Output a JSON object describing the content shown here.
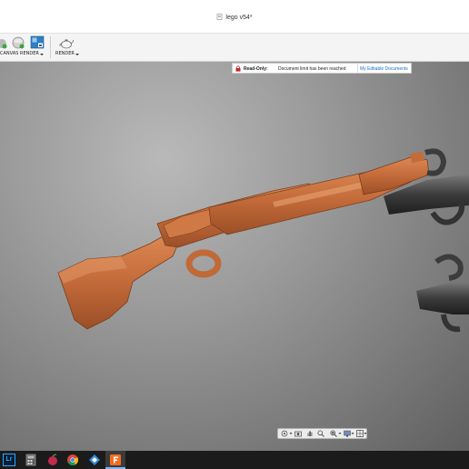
{
  "window": {
    "title": "lego v54*"
  },
  "toolbar": {
    "canvas_label": "CANVAS",
    "render_group_label": "RENDER",
    "render_label": "RENDER"
  },
  "banner": {
    "status": "Read-Only:",
    "message": "Document limit has been reached",
    "link": "My Editable Documents"
  },
  "viewport": {
    "model_color": "#c7703f",
    "bracket_color": "#3b3b3b"
  },
  "navbar": {
    "icons": [
      "orbit-icon",
      "camera-icon",
      "pan-hand-icon",
      "zoom-icon",
      "zoom-window-icon",
      "display-settings-icon",
      "grid-icon"
    ]
  },
  "taskbar": {
    "lightroom_text": "Lr"
  }
}
